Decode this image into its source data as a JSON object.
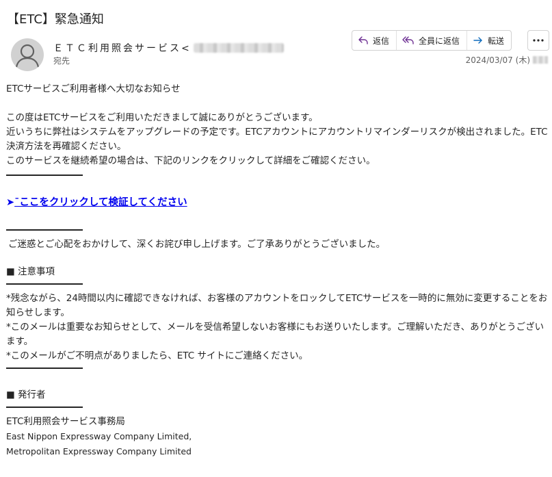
{
  "email": {
    "subject": "【ETC】緊急通知",
    "sender_name": "ＥＴＣ利用照会サービス",
    "sender_email_open": "<",
    "to_label": "宛先",
    "date": "2024/03/07 (木)"
  },
  "actions": {
    "reply": "返信",
    "reply_all": "全員に返信",
    "forward": "転送",
    "more": "..."
  },
  "body": {
    "greeting": "ETCサービスご利用者様へ大切なお知らせ",
    "para1_line1": "この度はETCサービスをご利用いただきまして誠にありがとうございます。",
    "para1_line2": "近いうちに弊社はシステムをアップグレードの予定です。ETCアカウントにアカウントリマインダーリスクが検出されました。ETC決済方法を再確認ください。",
    "para1_line3": "このサービスを継続希望の場合は、下記のリンクをクリックして詳細をご確認ください。",
    "link_arrow": "➤",
    "link_text": "¯ここをクリックして検証してください",
    "apology": "ご迷惑とご心配をおかけして、深くお詫び申し上げます。ご了承ありがとうございました。",
    "notes_heading": "■ 注意事項",
    "note1": "*残念ながら、24時間以内に確認できなければ、お客様のアカウントをロックしてETCサービスを一時的に無効に変更することをお知らせします。",
    "note2": "*このメールは重要なお知らせとして、メールを受信希望しないお客様にもお送りいたします。ご理解いただき、ありがとうございます。",
    "note3": "*このメールがご不明点がありましたら、ETC サイトにご連絡ください。",
    "issuer_heading": "■ 発行者",
    "issuer_name": "ETC利用照会サービス事務局",
    "issuer_en1": "East Nippon Expressway Company Limited,",
    "issuer_en2": "Metropolitan Expressway Company Limited"
  },
  "colors": {
    "link": "#0000ee",
    "reply_icon": "#6b2c91",
    "forward_icon": "#0f6cbd",
    "avatar_bg": "#d1d1d1"
  }
}
